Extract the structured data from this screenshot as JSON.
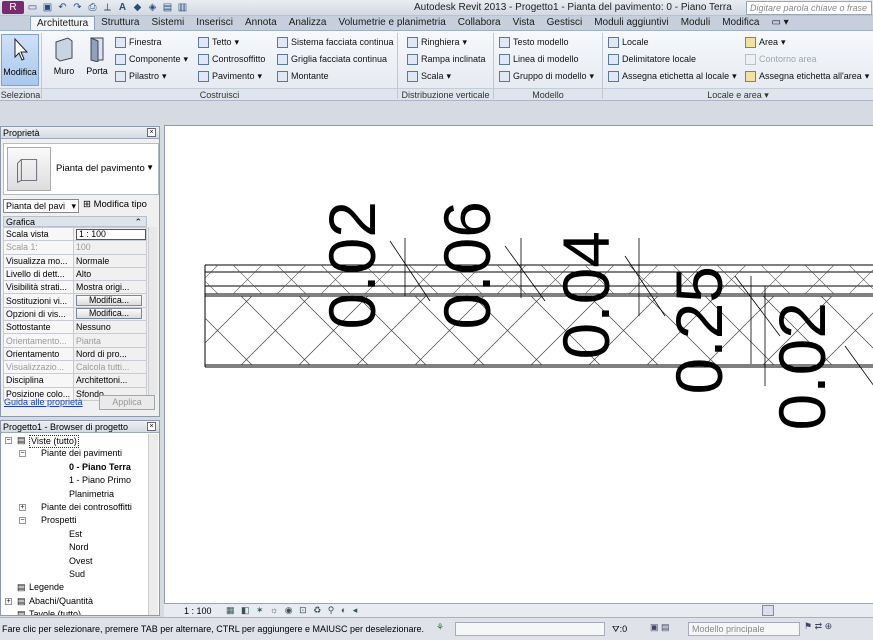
{
  "titlebar": {
    "app": "Autodesk Revit 2013 -",
    "doc": "Progetto1 - Pianta del pavimento: 0 - Piano Terra",
    "search_placeholder": "Digitare parola chiave o frase"
  },
  "tabs": [
    "Architettura",
    "Struttura",
    "Sistemi",
    "Inserisci",
    "Annota",
    "Analizza",
    "Volumetrie e planimetria",
    "Collabora",
    "Vista",
    "Gestisci",
    "Moduli aggiuntivi",
    "Moduli",
    "Modifica"
  ],
  "ribbon": {
    "modify": "Modifica",
    "wall": "Muro",
    "door": "Porta",
    "window": "Finestra",
    "component": "Componente",
    "column": "Pilastro",
    "roof": "Tetto",
    "ceiling": "Controsoffitto",
    "floor": "Pavimento",
    "curtain_system": "Sistema facciata continua",
    "curtain_grid": "Griglia facciata continua",
    "mullion": "Montante",
    "railing": "Ringhiera",
    "ramp": "Rampa inclinata",
    "stair": "Scala",
    "model_text": "Testo modello",
    "model_line": "Linea di modello",
    "model_group": "Gruppo di modello",
    "room": "Locale",
    "room_separator": "Delimitatore  locale",
    "tag_room": "Assegna etichetta  al locale",
    "area": "Area",
    "area_boundary": "Contorno  area",
    "tag_area": "Assegna etichetta  all'area",
    "panels": {
      "select": "Seleziona",
      "build": "Costruisci",
      "circulation": "Distribuzione verticale",
      "model": "Modello",
      "room_area": "Locale e area"
    }
  },
  "properties": {
    "title": "Proprietà",
    "type_name": "Pianta del pavimento",
    "instance_selector": "Pianta del pavi",
    "edit_type": "Modifica tipo",
    "group": "Grafica",
    "rows": [
      {
        "k": "Scala vista",
        "v": "1 : 100",
        "dis": false,
        "btn": false
      },
      {
        "k": "Scala  1:",
        "v": "100",
        "dis": true,
        "btn": false
      },
      {
        "k": "Visualizza mo...",
        "v": "Normale",
        "dis": false,
        "btn": false
      },
      {
        "k": "Livello di dett...",
        "v": "Alto",
        "dis": false,
        "btn": false
      },
      {
        "k": "Visibilità strati...",
        "v": "Mostra origi...",
        "dis": false,
        "btn": false
      },
      {
        "k": "Sostituzioni vi...",
        "v": "Modifica...",
        "dis": false,
        "btn": true
      },
      {
        "k": "Opzioni di vis...",
        "v": "Modifica...",
        "dis": false,
        "btn": true
      },
      {
        "k": "Sottostante",
        "v": "Nessuno",
        "dis": false,
        "btn": false
      },
      {
        "k": "Orientamento...",
        "v": "Pianta",
        "dis": true,
        "btn": false
      },
      {
        "k": "Orientamento",
        "v": "Nord di pro...",
        "dis": false,
        "btn": false
      },
      {
        "k": "Visualizzazio...",
        "v": "Calcola tutti...",
        "dis": true,
        "btn": false
      },
      {
        "k": "Disciplina",
        "v": "Architettoni...",
        "dis": false,
        "btn": false
      },
      {
        "k": "Posizione colo...",
        "v": "Sfondo",
        "dis": false,
        "btn": false
      }
    ],
    "help_link": "Guida alle proprietà",
    "apply": "Applica"
  },
  "browser": {
    "title": "Progetto1 - Browser di progetto",
    "nodes": [
      {
        "label": "Viste (tutto)",
        "indent": 0,
        "exp": "-",
        "bold": false,
        "sel": true
      },
      {
        "label": "Piante dei pavimenti",
        "indent": 1,
        "exp": "-",
        "bold": false
      },
      {
        "label": "0 - Piano Terra",
        "indent": 2,
        "exp": "",
        "bold": true
      },
      {
        "label": "1 - Piano Primo",
        "indent": 2,
        "exp": "",
        "bold": false
      },
      {
        "label": "Planimetria",
        "indent": 2,
        "exp": "",
        "bold": false
      },
      {
        "label": "Piante dei controsoffitti",
        "indent": 1,
        "exp": "+",
        "bold": false
      },
      {
        "label": "Prospetti",
        "indent": 1,
        "exp": "-",
        "bold": false
      },
      {
        "label": "Est",
        "indent": 2,
        "exp": "",
        "bold": false
      },
      {
        "label": "Nord",
        "indent": 2,
        "exp": "",
        "bold": false
      },
      {
        "label": "Ovest",
        "indent": 2,
        "exp": "",
        "bold": false
      },
      {
        "label": "Sud",
        "indent": 2,
        "exp": "",
        "bold": false
      },
      {
        "label": "Legende",
        "indent": 0,
        "exp": "",
        "bold": false
      },
      {
        "label": "Abachi/Quantità",
        "indent": 0,
        "exp": "+",
        "bold": false
      },
      {
        "label": "Tavole (tutto)",
        "indent": 0,
        "exp": "",
        "bold": false
      }
    ]
  },
  "canvas": {
    "dimensions": [
      "0.02",
      "0.06",
      "0.04",
      "0.25",
      "0.02"
    ]
  },
  "viewbar": {
    "scale": "1 : 100"
  },
  "status": {
    "text": "Fare clic per selezionare, premere TAB per alternare, CTRL per aggiungere e MAIUSC per deselezionare.",
    "count": ":0",
    "model": "Modello principale"
  }
}
